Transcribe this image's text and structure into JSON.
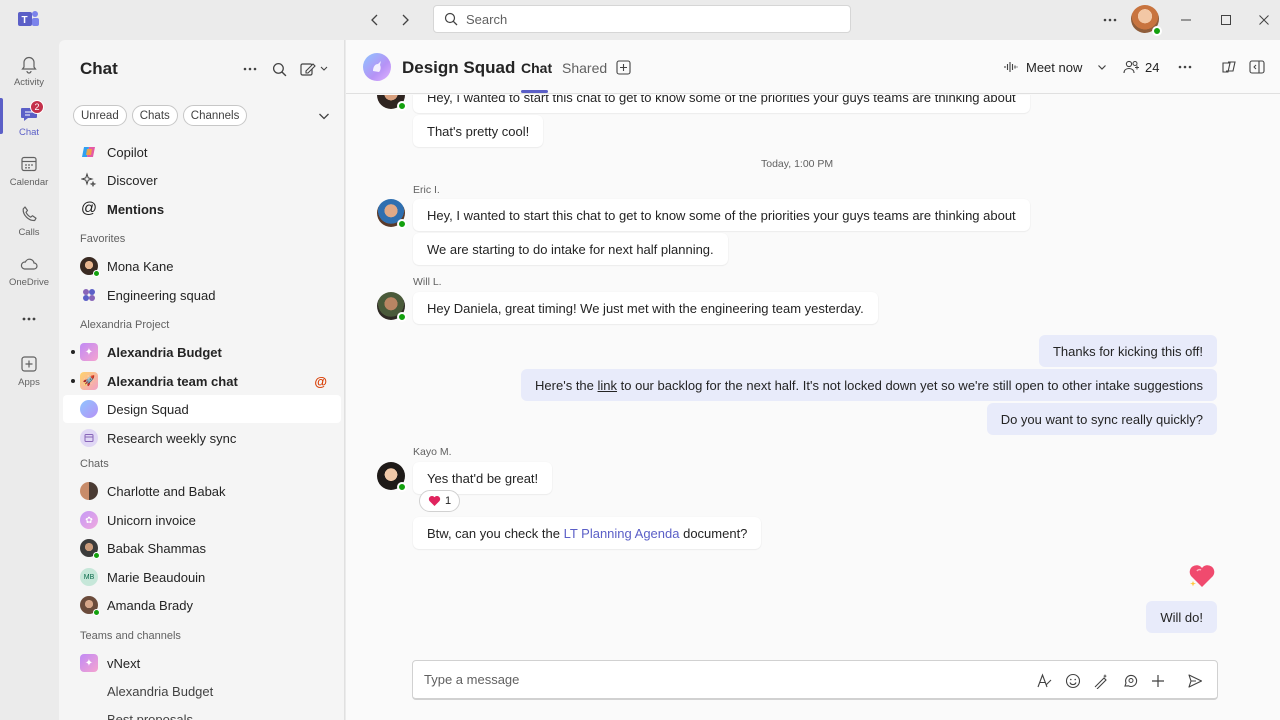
{
  "titlebar": {
    "search_placeholder": "Search",
    "icons": [
      "teams-logo-icon",
      "back-arrow-icon",
      "forward-arrow-icon",
      "search-icon",
      "more-icon",
      "minimize-icon",
      "maximize-icon",
      "close-icon"
    ]
  },
  "rail": {
    "items": [
      {
        "label": "Activity",
        "icon": "bell-icon"
      },
      {
        "label": "Chat",
        "icon": "chat-icon",
        "badge": "2",
        "active": true
      },
      {
        "label": "Calendar",
        "icon": "calendar-icon"
      },
      {
        "label": "Calls",
        "icon": "phone-icon"
      },
      {
        "label": "OneDrive",
        "icon": "cloud-icon"
      },
      {
        "label": "",
        "icon": "more-apps-icon"
      },
      {
        "label": "Apps",
        "icon": "add-apps-icon"
      }
    ]
  },
  "list": {
    "title": "Chat",
    "filters": [
      "Unread",
      "Chats",
      "Channels"
    ],
    "pinned": [
      {
        "label": "Copilot"
      },
      {
        "label": "Discover"
      },
      {
        "label": "Mentions"
      }
    ],
    "favorites_heading": "Favorites",
    "favorites": [
      {
        "label": "Mona Kane"
      },
      {
        "label": "Engineering squad"
      }
    ],
    "project_heading": "Alexandria Project",
    "project": [
      {
        "label": "Alexandria Budget"
      },
      {
        "label": "Alexandria team chat",
        "mention": "@"
      },
      {
        "label": "Design Squad"
      },
      {
        "label": "Research weekly sync"
      }
    ],
    "chats_heading": "Chats",
    "chats": [
      {
        "label": "Charlotte and Babak"
      },
      {
        "label": "Unicorn invoice"
      },
      {
        "label": "Babak Shammas"
      },
      {
        "label": "Marie Beaudouin",
        "initials": "MB"
      },
      {
        "label": "Amanda Brady"
      }
    ],
    "teams_heading": "Teams and channels",
    "teams": [
      {
        "label": "vNext"
      },
      {
        "label": "Alexandria Budget"
      },
      {
        "label": "Best proposals"
      }
    ]
  },
  "header": {
    "name": "Design Squad",
    "tabs": [
      "Chat",
      "Shared"
    ],
    "meet_now": "Meet now",
    "participants": "24"
  },
  "messages": {
    "m0": "Hey, I wanted to start this chat to get to know some of the priorities your guys teams are thinking about",
    "m1": "That's pretty cool!",
    "timestamp": "Today, 1:00 PM",
    "eric": {
      "sender": "Eric I.",
      "m1": "Hey, I wanted to start this chat to get to know some of the priorities your guys teams are thinking about",
      "m2": "We are starting to do intake for next half planning."
    },
    "will": {
      "sender": "Will L.",
      "m1": "Hey Daniela, great timing! We just met with the engineering team yesterday."
    },
    "me": {
      "m1": "Thanks for kicking this off!",
      "m2_pre": "Here's the ",
      "m2_link": "link",
      "m2_post": " to our backlog for the next half. It's not locked down yet so we're still open to other intake suggestions",
      "m3": "Do you want to sync really quickly?"
    },
    "kayo": {
      "sender": "Kayo M.",
      "m1": "Yes that'd be great!",
      "reaction_count": "1",
      "m2_pre": "Btw, can you check the ",
      "m2_link": "LT Planning Agenda",
      "m2_post": " document?"
    },
    "me_final": "Will do!"
  },
  "composer": {
    "placeholder": "Type a message"
  },
  "colors": {
    "accent": "#5b5fc7",
    "presence": "#13a10e",
    "badge": "#c4314b",
    "mention": "#d83b01",
    "my_bubble": "#e8ebfa"
  }
}
